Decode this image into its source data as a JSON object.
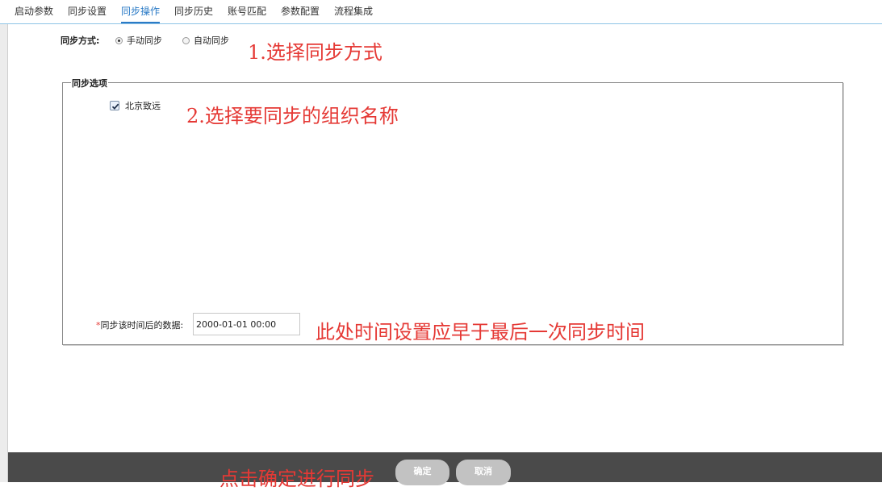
{
  "tabs": [
    {
      "label": "启动参数",
      "active": false
    },
    {
      "label": "同步设置",
      "active": false
    },
    {
      "label": "同步操作",
      "active": true
    },
    {
      "label": "同步历史",
      "active": false
    },
    {
      "label": "账号匹配",
      "active": false
    },
    {
      "label": "参数配置",
      "active": false
    },
    {
      "label": "流程集成",
      "active": false
    }
  ],
  "sync_mode": {
    "label": "同步方式:",
    "options": [
      {
        "label": "手动同步",
        "checked": true
      },
      {
        "label": "自动同步",
        "checked": false
      }
    ]
  },
  "options_group": {
    "legend": "同步选项",
    "orgs": [
      {
        "label": "北京致远",
        "checked": true
      }
    ]
  },
  "date_filter": {
    "required_mark": "*",
    "label": "同步该时间后的数据:",
    "value": "2000-01-01 00:00"
  },
  "footer": {
    "confirm_label": "确定",
    "cancel_label": "取消"
  },
  "annotations": {
    "step1": "1.选择同步方式",
    "step2": "2.选择要同步的组织名称",
    "time_note": "此处时间设置应早于最后一次同步时间",
    "confirm_note": "点击确定进行同步"
  },
  "colors": {
    "accent": "#2b7bc6",
    "annotation": "#e53935",
    "footer_bg": "#4a4a4a",
    "button_bg": "#c2c2c2"
  }
}
